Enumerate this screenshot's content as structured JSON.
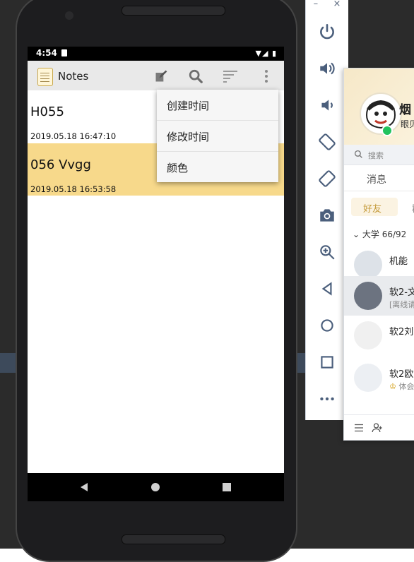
{
  "status_bar": {
    "time": "4:54",
    "icons_text": "▼◢ ▮"
  },
  "action_bar": {
    "app_title": "Notes"
  },
  "notes": [
    {
      "title": "H055",
      "date": "2019.05.18 16:47:10",
      "bg": "#ffffff"
    },
    {
      "title": "056 Vvgg",
      "date": "2019.05.18 16:53:58",
      "bg": "#f7d98b"
    }
  ],
  "sort_menu": {
    "items": [
      "创建时间",
      "修改时间",
      "颜色"
    ]
  },
  "emulator": {
    "minimize": "–",
    "close": "×"
  },
  "qq": {
    "profile_name": "烟",
    "signature": "眼贝",
    "search_placeholder": "搜索",
    "tab_messages": "消息",
    "tab_friends": "好友",
    "tab_other": "群",
    "group_label": "大学  66/92",
    "contacts": [
      {
        "name": "机能",
        "status": ""
      },
      {
        "name": "软2-文",
        "status": "[离线请"
      },
      {
        "name": "软2刘",
        "status": ""
      },
      {
        "name": "软2欧",
        "status": "体会"
      }
    ]
  },
  "colors": {
    "accent_yellow": "#f7d98b",
    "qq_online": "#22c35e"
  }
}
